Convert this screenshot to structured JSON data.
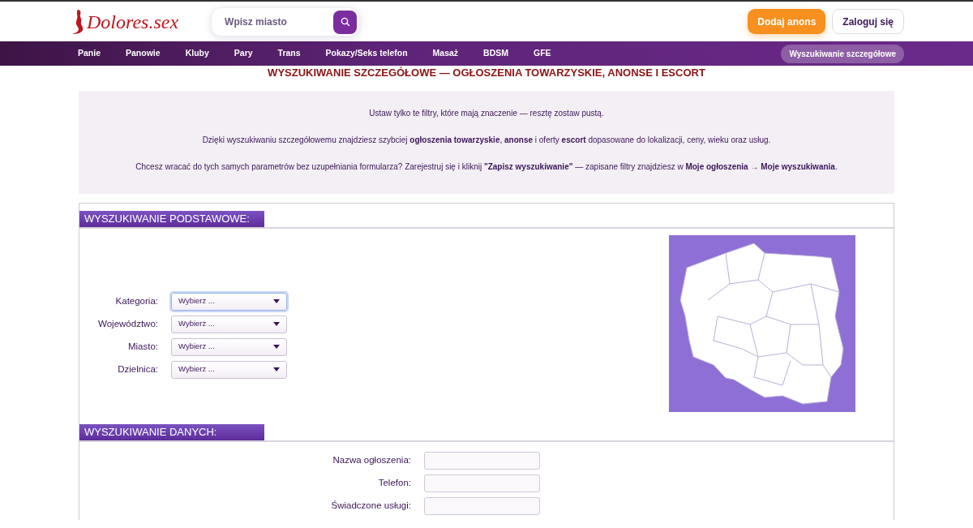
{
  "header": {
    "logo": "Dolores.sex",
    "search": {
      "placeholder": "Wpisz miasto"
    },
    "buttons": [
      {
        "label": "Dodaj anons",
        "kind": "primary"
      },
      {
        "label": "Zaloguj się",
        "kind": "outline"
      }
    ]
  },
  "nav": {
    "items": [
      {
        "label": "Panie"
      },
      {
        "label": "Panowie"
      },
      {
        "label": "Kluby"
      },
      {
        "label": "Pary"
      },
      {
        "label": "Trans"
      },
      {
        "label": "Pokazy/Seks telefon"
      },
      {
        "label": "Masaż"
      },
      {
        "label": "BDSM"
      },
      {
        "label": "GFE"
      }
    ],
    "advanced_link": {
      "label": "Wyszukiwanie szczegółowe",
      "selected": true
    }
  },
  "page_title": "WYSZUKIWANIE SZCZEGÓŁOWE — OGŁOSZENIA TOWARZYSKIE, ANONSE I ESCORT",
  "intro": [
    "Ustaw tylko te filtry, które mają znaczenie — resztę zostaw pustą.",
    "Dzięki wyszukiwaniu szczegółowemu znajdziesz szybciej **ogłoszenia towarzyskie**, **anonse** i oferty **escort** dopasowane do lokalizacji, ceny, wieku oraz usług.",
    "Chcesz wracać do tych samych parametrów bez uzupełniania formularza? Zarejestruj się i kliknij **\"Zapisz wyszukiwanie\"** — zapisane filtry znajdziesz w **Moje ogłoszenia → Moje wyszukiwania**."
  ],
  "sections": [
    {
      "title": "WYSZUKIWANIE PODSTAWOWE:",
      "kind": "with_map",
      "fields": [
        {
          "kind": "select",
          "label": "Kategoria:",
          "value": "Wybierz ...",
          "focused": true
        },
        {
          "kind": "select",
          "label": "Województwo:",
          "value": "Wybierz ...",
          "focused": false
        },
        {
          "kind": "select",
          "label": "Miasto:",
          "value": "Wybierz ...",
          "focused": false
        },
        {
          "kind": "select",
          "label": "Dzielnica:",
          "value": "Wybierz ...",
          "focused": false
        }
      ]
    },
    {
      "title": "WYSZUKIWANIE DANYCH:",
      "kind": "plain",
      "fields": [
        {
          "kind": "text",
          "label": "Nazwa ogłoszenia:",
          "focused": false
        },
        {
          "kind": "text",
          "label": "Telefon:",
          "focused": false
        },
        {
          "kind": "text",
          "label": "Świadczone usługi:",
          "focused": false
        }
      ]
    }
  ]
}
